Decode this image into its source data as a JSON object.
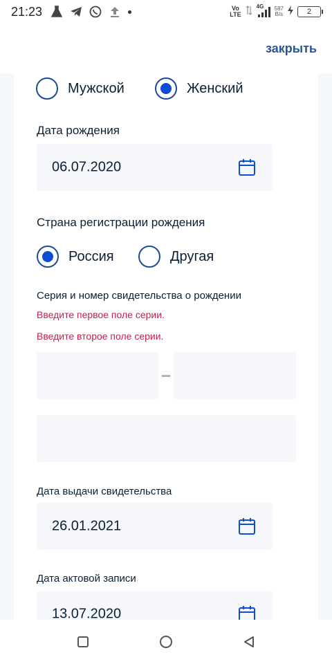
{
  "status_bar": {
    "time": "21:23",
    "network_top": "Vo",
    "network_bottom": "LTE",
    "signal_label": "4G",
    "speed_value": "587",
    "speed_unit": "B/s",
    "battery": "2"
  },
  "header": {
    "close_label": "закрыть"
  },
  "gender": {
    "options": [
      {
        "label": "Мужской",
        "checked": false
      },
      {
        "label": "Женский",
        "checked": true
      }
    ]
  },
  "birth_date": {
    "label": "Дата рождения",
    "value": "06.07.2020"
  },
  "birth_country": {
    "label": "Страна регистрации рождения",
    "options": [
      {
        "label": "Россия",
        "checked": true
      },
      {
        "label": "Другая",
        "checked": false
      }
    ]
  },
  "certificate": {
    "label": "Серия и номер свидетельства о рождении",
    "errors": [
      "Введите первое поле серии.",
      "Введите второе поле серии."
    ],
    "series_part1": "",
    "series_part2": "",
    "number": ""
  },
  "issue_date": {
    "label": "Дата выдачи свидетельства",
    "value": "26.01.2021"
  },
  "record_date": {
    "label": "Дата актовой записи",
    "value": "13.07.2020"
  },
  "colors": {
    "accent": "#0d4cd3",
    "link": "#2a5694",
    "error": "#c1224b",
    "field_bg": "#f5f7fa"
  }
}
